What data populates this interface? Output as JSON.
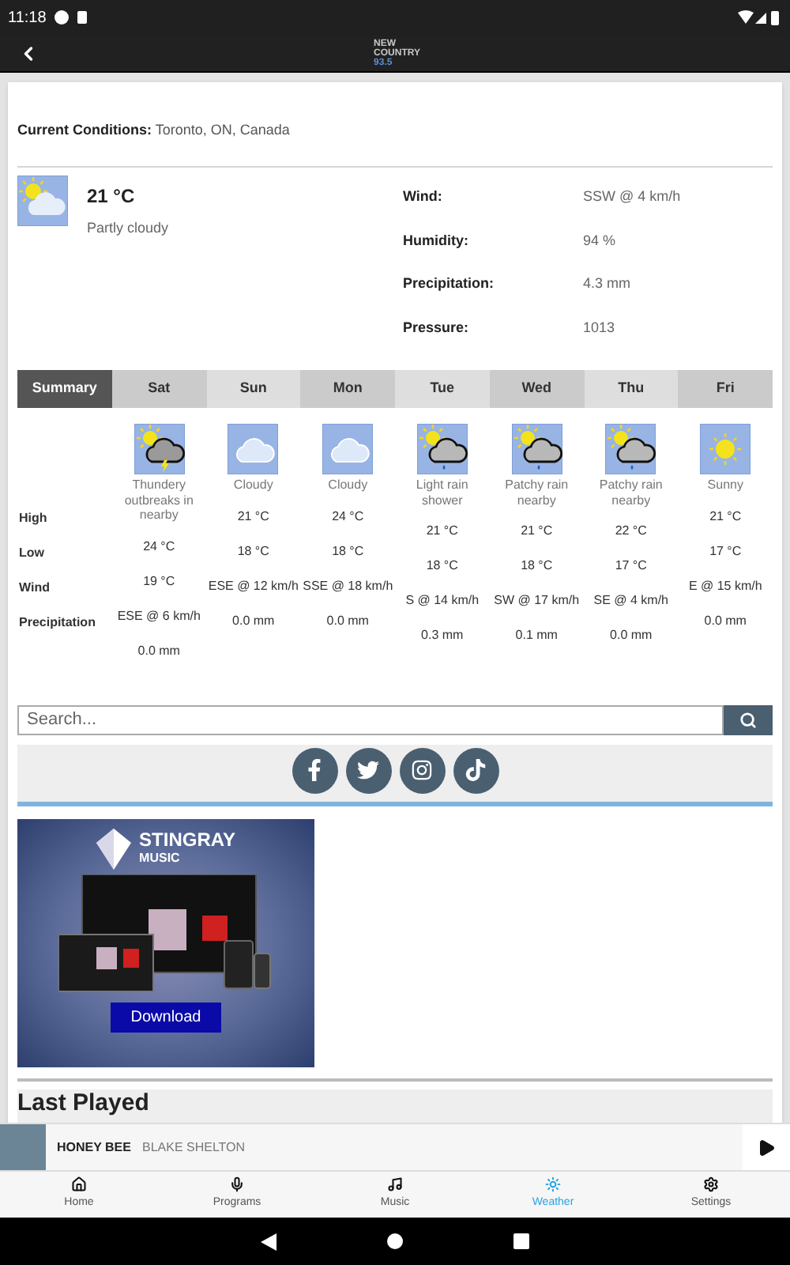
{
  "status_bar": {
    "time": "11:18"
  },
  "app_bar": {
    "logo": [
      "NEW",
      "COUNTRY",
      "93.5"
    ]
  },
  "current": {
    "label": "Current Conditions:",
    "location": "Toronto, ON, Canada",
    "kind": "partly_cloudy",
    "temperature": "21 °C",
    "description": "Partly cloudy",
    "details": [
      {
        "label": "Wind:",
        "value": "SSW @ 4 km/h"
      },
      {
        "label": "Humidity:",
        "value": "94 %"
      },
      {
        "label": "Precipitation:",
        "value": "4.3 mm"
      },
      {
        "label": "Pressure:",
        "value": "1013"
      }
    ]
  },
  "forecast": {
    "summary_tab": {
      "label": "Summary",
      "selected": true
    },
    "row_labels": [
      "High",
      "Low",
      "Wind",
      "Precipitation"
    ],
    "days": [
      {
        "label": "Sat",
        "selected": false,
        "kind": "thunder",
        "description": "Thundery outbreaks in nearby",
        "high": "24 °C",
        "low": "19 °C",
        "wind": "ESE @ 6 km/h",
        "precipitation": "0.0 mm"
      },
      {
        "label": "Sun",
        "selected": false,
        "kind": "cloudy",
        "description": "Cloudy",
        "high": "21 °C",
        "low": "18 °C",
        "wind": "ESE @ 12 km/h",
        "precipitation": "0.0 mm"
      },
      {
        "label": "Mon",
        "selected": false,
        "kind": "cloudy",
        "description": "Cloudy",
        "high": "24 °C",
        "low": "18 °C",
        "wind": "SSE @ 18 km/h",
        "precipitation": "0.0 mm"
      },
      {
        "label": "Tue",
        "selected": false,
        "kind": "rain",
        "description": "Light rain shower",
        "high": "21 °C",
        "low": "18 °C",
        "wind": "S @ 14 km/h",
        "precipitation": "0.3 mm"
      },
      {
        "label": "Wed",
        "selected": false,
        "kind": "rain",
        "description": "Patchy rain nearby",
        "high": "21 °C",
        "low": "18 °C",
        "wind": "SW @ 17 km/h",
        "precipitation": "0.1 mm"
      },
      {
        "label": "Thu",
        "selected": false,
        "kind": "rain",
        "description": "Patchy rain nearby",
        "high": "22 °C",
        "low": "17 °C",
        "wind": "SE @ 4 km/h",
        "precipitation": "0.0 mm"
      },
      {
        "label": "Fri",
        "selected": false,
        "kind": "sunny",
        "description": "Sunny",
        "high": "21 °C",
        "low": "17 °C",
        "wind": "E @ 15 km/h",
        "precipitation": "0.0 mm"
      }
    ]
  },
  "search": {
    "placeholder": "Search..."
  },
  "ad": {
    "brand": "STINGRAY",
    "subtitle": "MUSIC",
    "button": "Download"
  },
  "last_played": {
    "heading": "Last Played"
  },
  "player": {
    "title": "HONEY BEE",
    "artist": "BLAKE SHELTON"
  },
  "nav": [
    {
      "label": "Home",
      "selected": false
    },
    {
      "label": "Programs",
      "selected": false
    },
    {
      "label": "Music",
      "selected": false
    },
    {
      "label": "Weather",
      "selected": true
    },
    {
      "label": "Settings",
      "selected": false
    }
  ]
}
